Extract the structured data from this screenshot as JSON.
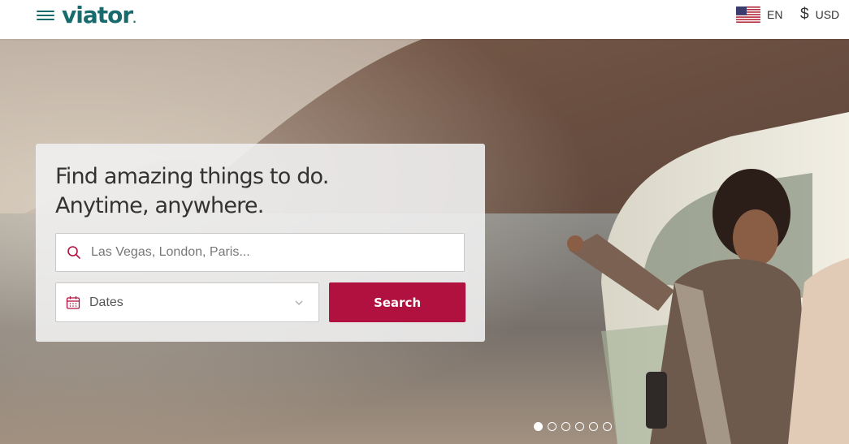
{
  "header": {
    "logo_text": "viator",
    "language": "EN",
    "currency_symbol": "$",
    "currency": "USD",
    "icons": [
      "menu-icon",
      "us-flag-icon"
    ]
  },
  "hero": {
    "headline_line1": "Find amazing things to do.",
    "headline_line2": "Anytime, anywhere.",
    "search_placeholder": "Las Vegas, London, Paris...",
    "search_value": "",
    "dates_label": "Dates",
    "search_button": "Search",
    "icons": [
      "search-icon",
      "calendar-icon",
      "chevron-down-icon"
    ],
    "carousel": {
      "total": 6,
      "active": 1
    }
  },
  "colors": {
    "brand": "#186b6d",
    "accent": "#b0113e"
  }
}
